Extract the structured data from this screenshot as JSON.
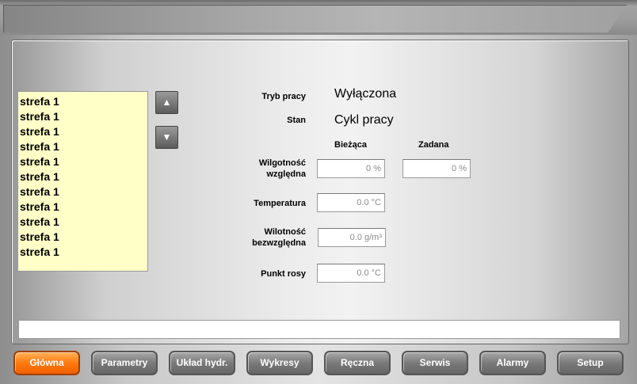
{
  "zones": [
    "strefa 1",
    "strefa 1",
    "strefa 1",
    "strefa 1",
    "strefa 1",
    "strefa 1",
    "strefa 1",
    "strefa 1",
    "strefa 1",
    "strefa 1",
    "strefa 1"
  ],
  "labels": {
    "mode": "Tryb pracy",
    "state": "Stan",
    "col_current": "Bieżąca",
    "col_set": "Zadana",
    "rel_humidity_1": "Wilgotność",
    "rel_humidity_2": "względna",
    "temperature": "Temperatura",
    "abs_humidity_1": "Wilotność",
    "abs_humidity_2": "bezwzględna",
    "dew_point": "Punkt rosy"
  },
  "values": {
    "mode": "Wyłączona",
    "state": "Cykl pracy",
    "rel_humidity_current": "0 %",
    "rel_humidity_set": "0 %",
    "temperature": "0.0 °C",
    "abs_humidity": "0.0 g/m³",
    "dew_point": "0.0 °C"
  },
  "icons": {
    "up": "arrow-up-icon",
    "down": "arrow-down-icon"
  },
  "nav": [
    "Główna",
    "Parametry",
    "Układ hydr.",
    "Wykresy",
    "Ręczna",
    "Serwis",
    "Alarmy",
    "Setup"
  ],
  "colors": {
    "accent": "#ff7a10",
    "list_bg": "#ffffc8"
  }
}
